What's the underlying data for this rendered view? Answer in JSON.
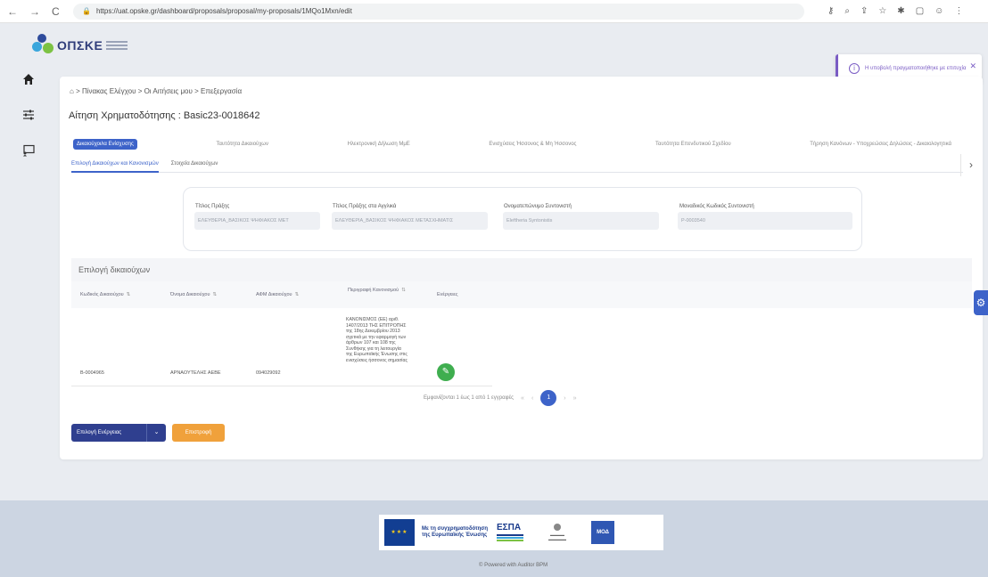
{
  "browser": {
    "url": "https://uat.opske.gr/dashboard/proposals/proposal/my-proposals/1MQo1Mxn/edit"
  },
  "logo": {
    "text": "ΟΠΣΚΕ"
  },
  "sidebar": {
    "items": [
      {
        "icon": "home-icon"
      },
      {
        "icon": "sliders-icon"
      },
      {
        "icon": "presentation-icon"
      }
    ]
  },
  "toast": {
    "message": "Η υποβολή πραγματοποιήθηκε με επιτυχία"
  },
  "breadcrumb": "> Πίνακας Ελέγχου > Οι Αιτήσεις μου > Επεξεργασία",
  "page_title": "Αίτηση Χρηματοδότησης : Basic23-0018642",
  "tabs": [
    "Δικαιούχοι/ια Ενίσχυσης",
    "Ταυτότητα Δικαιούχων",
    "Ηλεκτρονική Δήλωση ΜμΕ",
    "Ενισχύσεις Ήσσονος & Μη Ήσσονος",
    "Ταυτότητα Επενδυτικού Σχεδίου",
    "Τήρηση Κανόνων - Υποχρεώσεις Δηλώσεις - Δικαιολογητικά"
  ],
  "subtabs": [
    "Επιλογή Δικαιούχων και Κανονισμών",
    "Στοιχεία Δικαιούχων"
  ],
  "fields": [
    {
      "label": "Τίτλος Πράξης",
      "value": "ΕΛΕΥΘΕΡΙΑ_ΒΑΣΙΚΟΣ ΨΗΦΙΑΚΟΣ ΜΕΤ"
    },
    {
      "label": "Τίτλος Πράξης στα Αγγλικά",
      "value": "ΕΛΕΥΘΕΡΙΑ_ΒΑΣΙΚΟΣ ΨΗΦΙΑΚΟΣ ΜΕΤΑΣΧΗΜΑΤΙΣ"
    },
    {
      "label": "Ονοματεπώνυμο Συντονιστή",
      "value": "Eleftheria Syntonistis"
    },
    {
      "label": "Μοναδικός Κωδικός Συντονιστή",
      "value": "P-0003540"
    }
  ],
  "table": {
    "title": "Επιλογή δικαιούχων",
    "headers": [
      "Κωδικός Δικαιούχου",
      "Όνομα Δικαιούχου",
      "ΑΦΜ Δικαιούχου",
      "Περιγραφή Κανονισμού",
      "Ενέργειες"
    ],
    "rows": [
      {
        "code": "B-0004965",
        "name": "ΑΡΝΑΟΥΤΕΛΗΣ ΑΕΒΕ",
        "afm": "094029092",
        "regulation": "ΚΑΝΟΝΙΣΜΟΣ (ΕΕ) αριθ. 1407/2013 ΤΗΣ ΕΠΙΤΡΟΠΗΣ της 18ης Δεκεμβρίου 2013 σχετικά με την εφαρμογή των άρθρων 107 και 108 της Συνθήκης για τη λειτουργία της Ευρωπαϊκής Ένωσης στις ενισχύσεις ήσσονος σημασίας"
      }
    ]
  },
  "pagination": {
    "summary": "Εμφανίζονται 1 έως 1 από 1 εγγραφές",
    "first": "«",
    "prev": "‹",
    "current": "1",
    "next": "›",
    "last": "»"
  },
  "buttons": {
    "actions": "Επιλογή Ενέργειας",
    "return": "Επιστροφή"
  },
  "footer": {
    "eu_text": "Με τη συγχρηματοδότηση της Ευρωπαϊκής Ένωσης",
    "espa": "ΕΣΠΑ",
    "moa": "ΜΟΔ",
    "powered": "© Powered with Auditor BPM"
  },
  "colors": {
    "primary": "#3d63c9",
    "navy": "#2f3f8f",
    "orange": "#f0a13b",
    "green": "#3fae4f",
    "toast": "#7a5cc4"
  }
}
